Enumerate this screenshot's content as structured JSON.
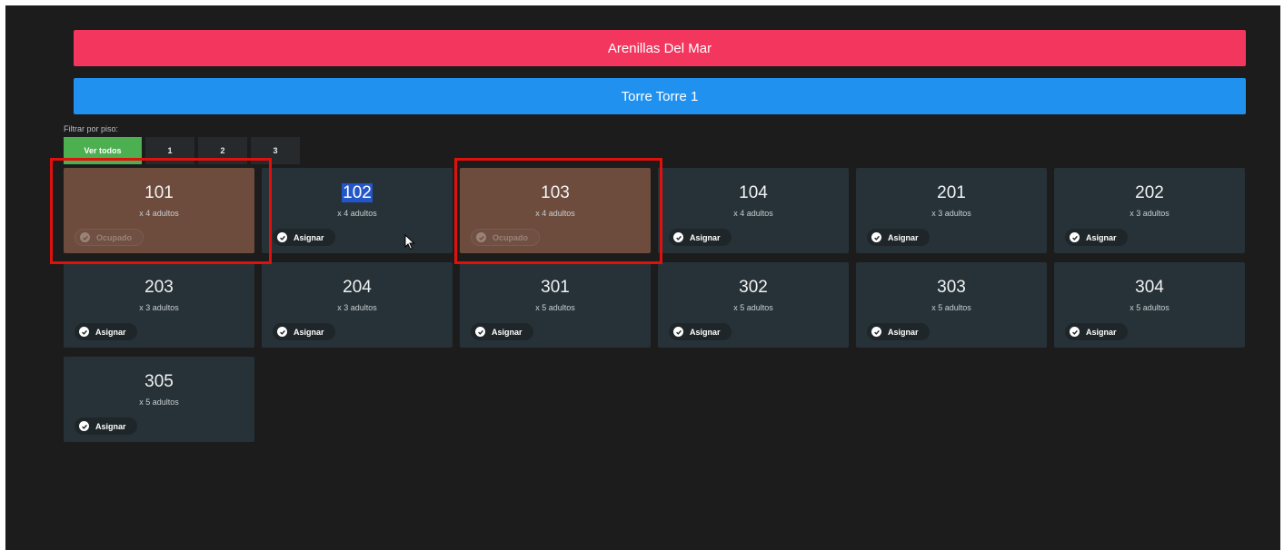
{
  "hotel": {
    "name": "Arenillas Del Mar",
    "color": "#f2365e"
  },
  "tower": {
    "name": "Torre Torre 1",
    "color": "#2191f0"
  },
  "filter": {
    "label": "Filtrar por piso:",
    "options": [
      "Ver todos",
      "1",
      "2",
      "3"
    ],
    "selected": "Ver todos"
  },
  "rooms": [
    {
      "number": "101",
      "capacity": "x 4 adultos",
      "action": "Ocupado",
      "status": "occupied"
    },
    {
      "number": "102",
      "capacity": "x 4 adultos",
      "action": "Asignar",
      "status": "available"
    },
    {
      "number": "103",
      "capacity": "x 4 adultos",
      "action": "Ocupado",
      "status": "occupied"
    },
    {
      "number": "104",
      "capacity": "x 4 adultos",
      "action": "Asignar",
      "status": "available"
    },
    {
      "number": "201",
      "capacity": "x 3 adultos",
      "action": "Asignar",
      "status": "available"
    },
    {
      "number": "202",
      "capacity": "x 3 adultos",
      "action": "Asignar",
      "status": "available"
    },
    {
      "number": "203",
      "capacity": "x 3 adultos",
      "action": "Asignar",
      "status": "available"
    },
    {
      "number": "204",
      "capacity": "x 3 adultos",
      "action": "Asignar",
      "status": "available"
    },
    {
      "number": "301",
      "capacity": "x 5 adultos",
      "action": "Asignar",
      "status": "available"
    },
    {
      "number": "302",
      "capacity": "x 5 adultos",
      "action": "Asignar",
      "status": "available"
    },
    {
      "number": "303",
      "capacity": "x 5 adultos",
      "action": "Asignar",
      "status": "available"
    },
    {
      "number": "304",
      "capacity": "x 5 adultos",
      "action": "Asignar",
      "status": "available"
    },
    {
      "number": "305",
      "capacity": "x 5 adultos",
      "action": "Asignar",
      "status": "available"
    }
  ],
  "colors": {
    "occupied": "#6d4c3d",
    "available": "#263238",
    "highlight": "#e0100c",
    "filter_active": "#4caf50"
  }
}
